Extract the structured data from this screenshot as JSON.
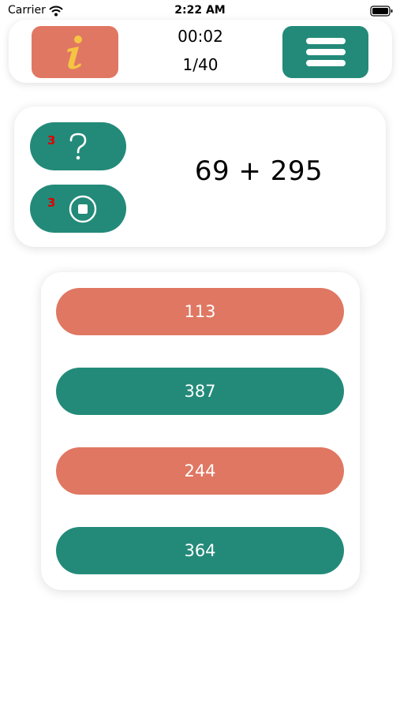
{
  "status_bar": {
    "carrier": "Carrier",
    "time": "2:22 AM",
    "wifi_icon": "wifi-icon",
    "battery_icon": "battery-icon"
  },
  "header": {
    "info_icon": "info-icon",
    "menu_icon": "hamburger-menu-icon",
    "timer": "00:02",
    "progress": "1/40"
  },
  "question": {
    "equation": "69 + 295",
    "powerups": [
      {
        "count": "3",
        "icon": "question-mark-icon"
      },
      {
        "count": "3",
        "icon": "stop-circle-icon"
      }
    ]
  },
  "answers": [
    {
      "label": "113",
      "color": "#e07762"
    },
    {
      "label": "387",
      "color": "#238a79"
    },
    {
      "label": "244",
      "color": "#e07762"
    },
    {
      "label": "364",
      "color": "#238a79"
    }
  ],
  "colors": {
    "coral": "#e07762",
    "teal": "#238a79",
    "info_glyph": "#f5c443",
    "count_red": "#e00000"
  }
}
